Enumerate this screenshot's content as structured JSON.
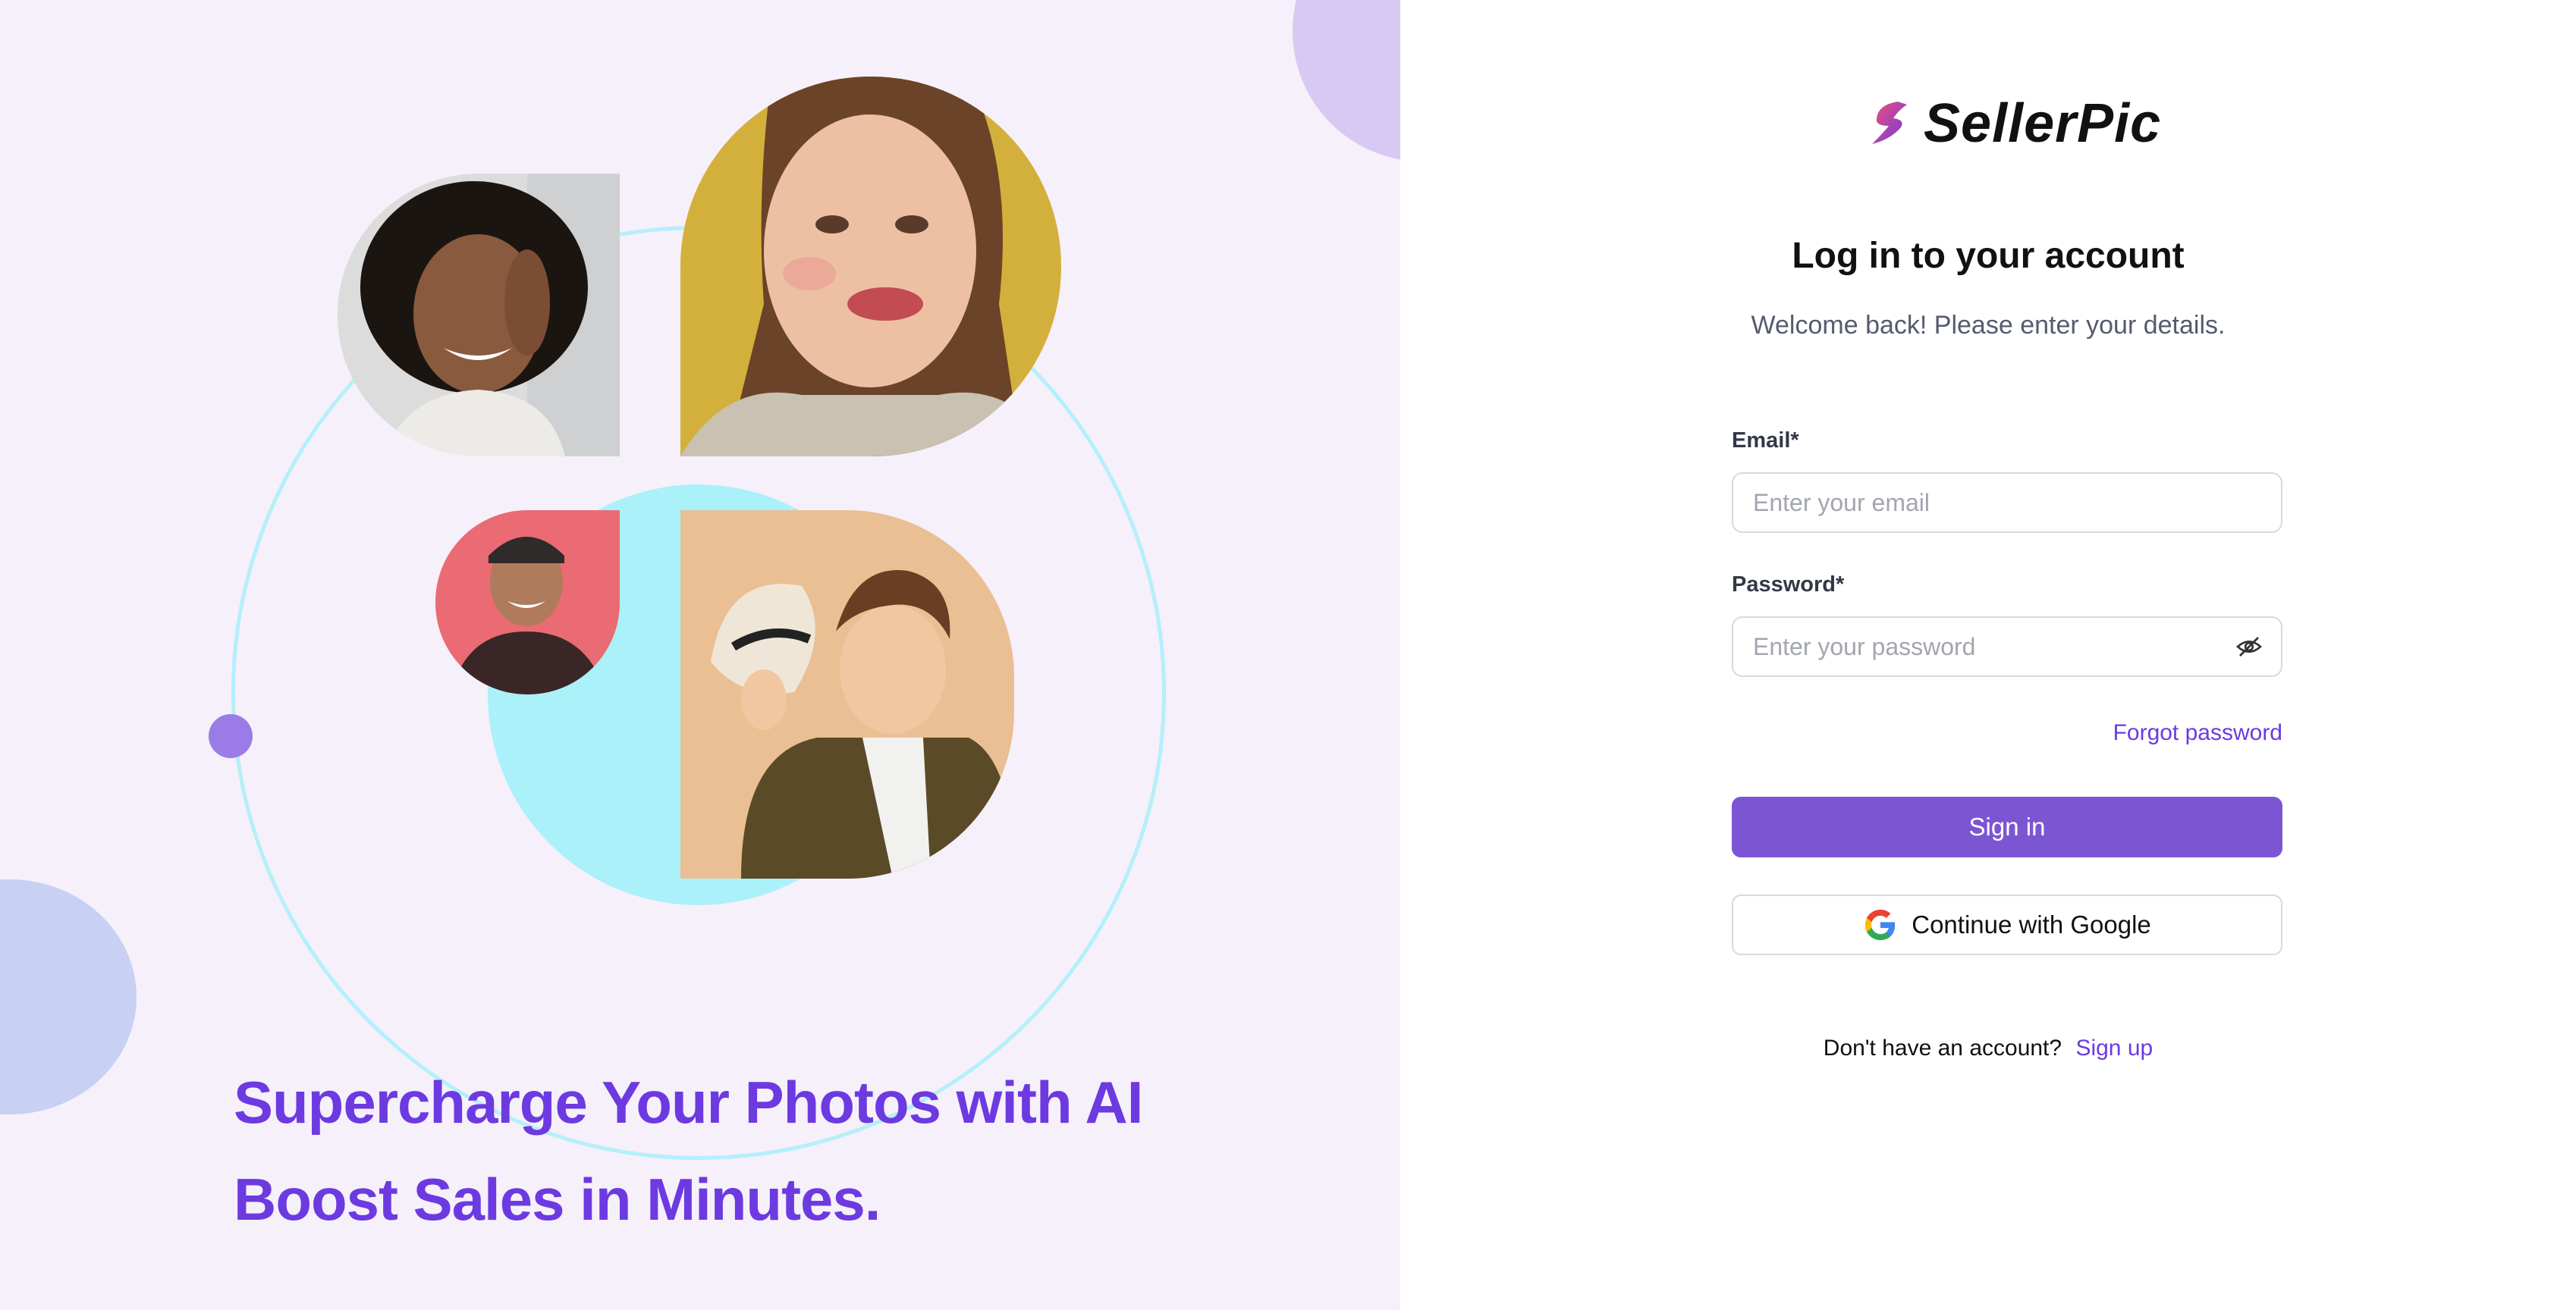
{
  "hero": {
    "headline_line1": "Supercharge Your Photos with AI",
    "headline_line2": "Boost Sales in Minutes."
  },
  "brand": {
    "name": "SellerPic",
    "accent": "#6c3ae0",
    "button_color": "#7c56d2"
  },
  "login": {
    "title": "Log in to your account",
    "subtitle": "Welcome back! Please enter your details.",
    "email_label": "Email*",
    "email_placeholder": "Enter your email",
    "password_label": "Password*",
    "password_placeholder": "Enter your password",
    "forgot_password": "Forgot password",
    "sign_in": "Sign in",
    "google": "Continue with Google",
    "no_account": "Don't have an account?",
    "sign_up": "Sign up"
  },
  "icons": {
    "logo": "bolt-logo-icon",
    "password_toggle": "eye-off-icon",
    "google": "google-g-icon"
  }
}
